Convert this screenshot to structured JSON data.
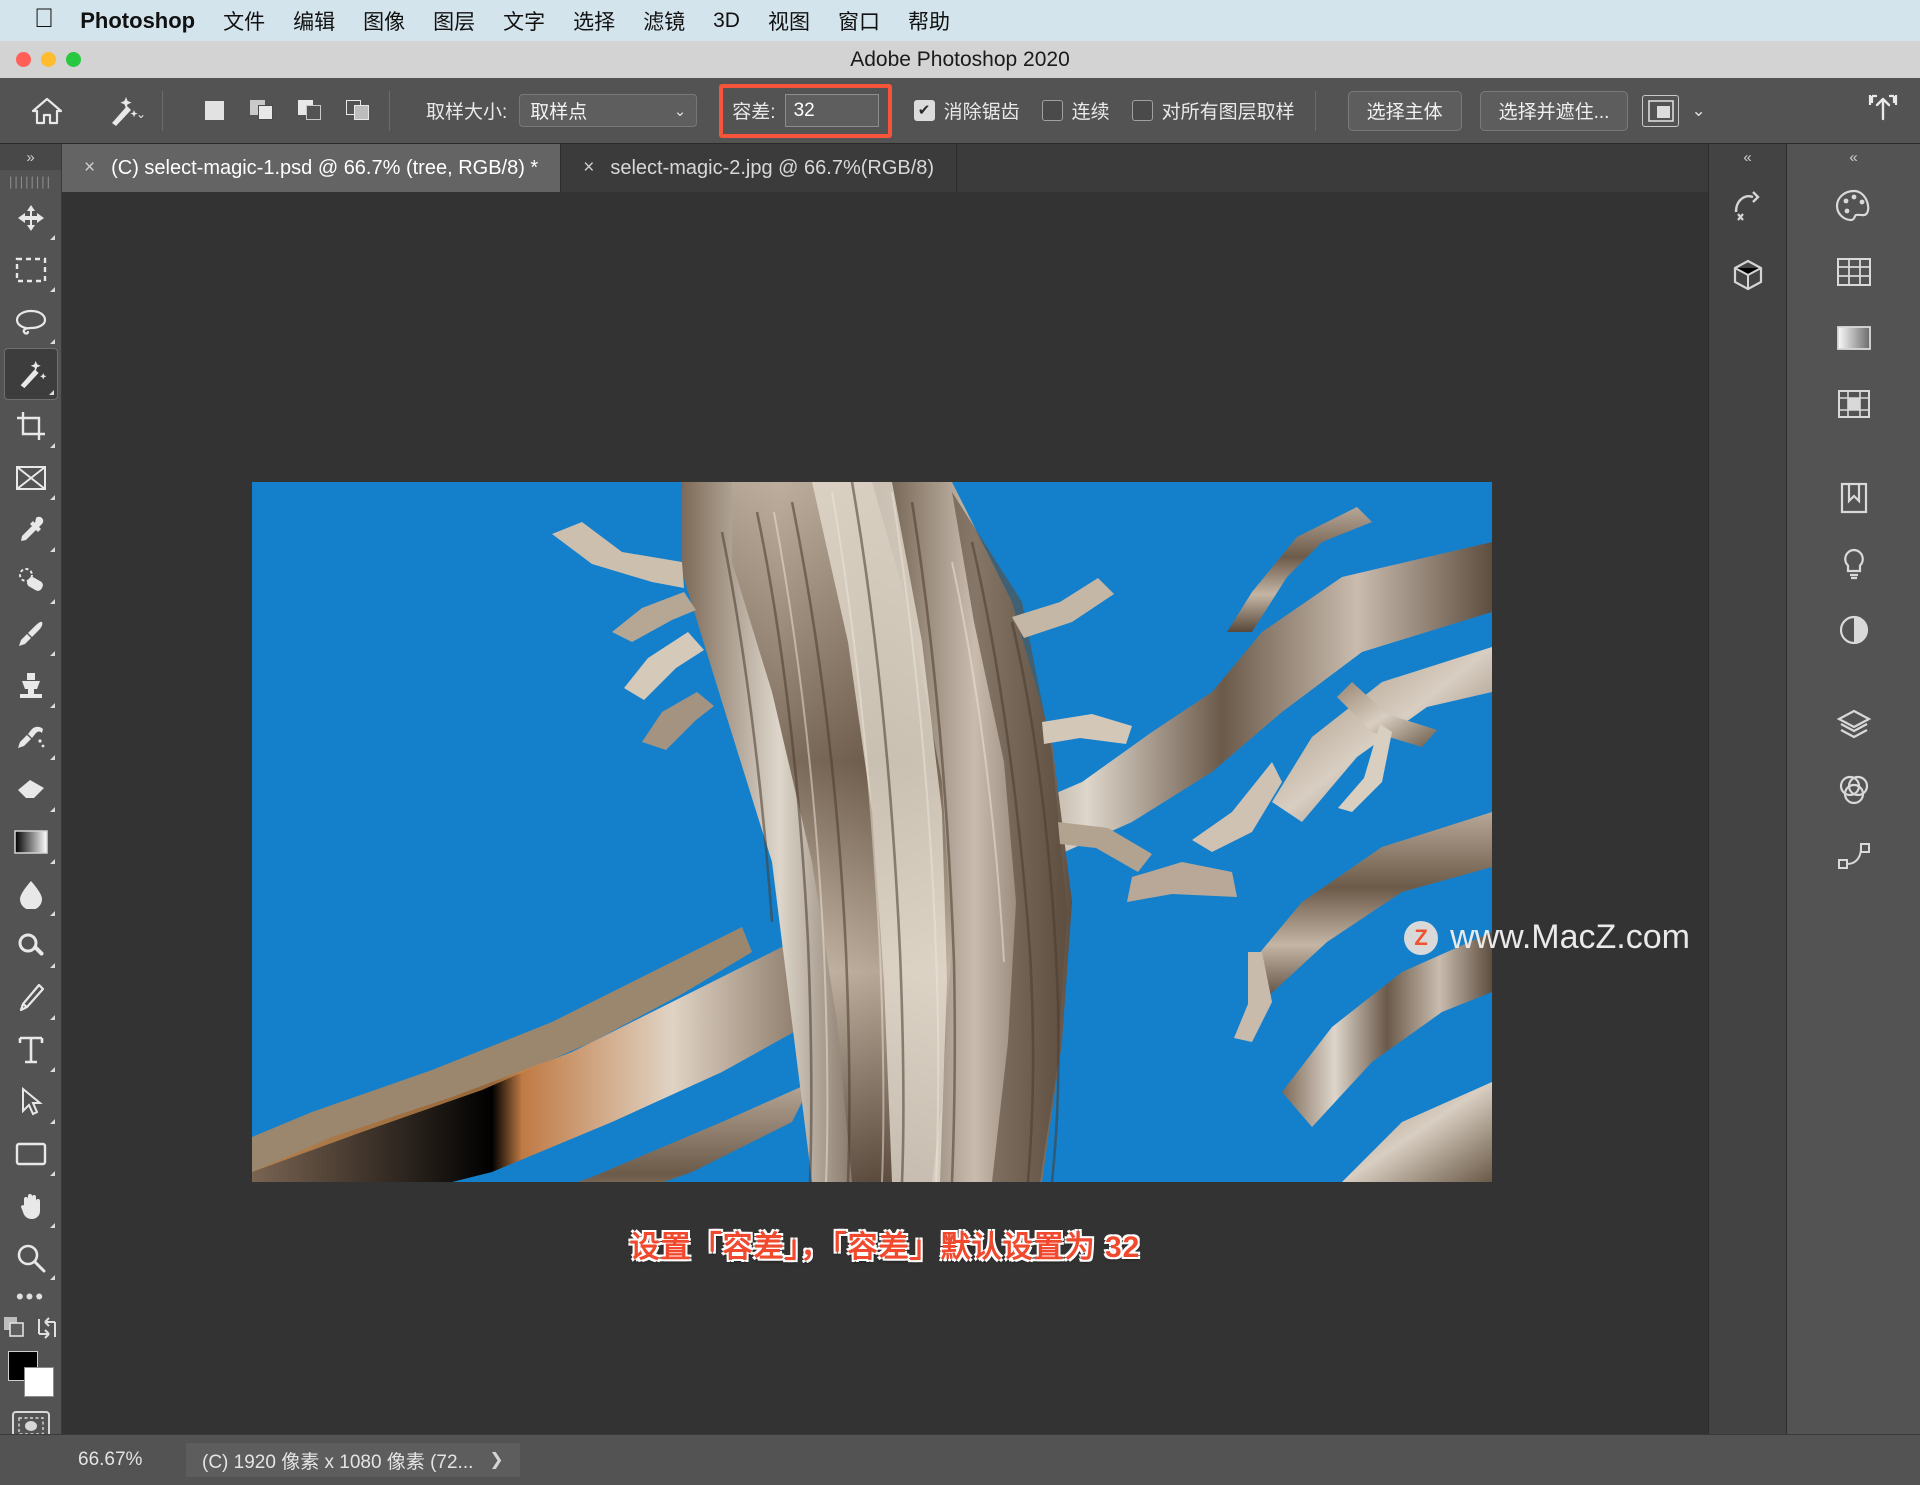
{
  "macmenu": {
    "apple_icon": "apple-icon",
    "app_name": "Photoshop",
    "items": [
      "文件",
      "编辑",
      "图像",
      "图层",
      "文字",
      "选择",
      "滤镜",
      "3D",
      "视图",
      "窗口",
      "帮助"
    ]
  },
  "window": {
    "title": "Adobe Photoshop 2020"
  },
  "options_bar": {
    "home_icon": "home-icon",
    "tool_icon": "magic-wand-icon",
    "tool_caret": "⌄",
    "selection_modes": [
      "new-selection-icon",
      "add-to-selection-icon",
      "subtract-from-selection-icon",
      "intersect-selection-icon"
    ],
    "sample_size_label": "取样大小:",
    "sample_size_value": "取样点",
    "sample_size_chevron": "⌄",
    "tolerance_label": "容差:",
    "tolerance_value": "32",
    "tolerance_highlight_color": "#f7543c",
    "antialias_label": "消除锯齿",
    "antialias_checked": true,
    "contiguous_label": "连续",
    "contiguous_checked": false,
    "sample_all_layers_label": "对所有图层取样",
    "sample_all_layers_checked": false,
    "select_subject_label": "选择主体",
    "select_and_mask_label": "选择并遮住...",
    "workspace_icon": "workspace-icon",
    "workspace_chevron": "⌄",
    "share_icon": "share-icon"
  },
  "toolbar": {
    "collapse_icon": "»",
    "tools": [
      {
        "name": "move-tool",
        "icon": "move-icon",
        "active": false
      },
      {
        "name": "marquee-tool",
        "icon": "rectangular-marquee-icon",
        "active": false
      },
      {
        "name": "lasso-tool",
        "icon": "lasso-icon",
        "active": false
      },
      {
        "name": "magic-wand-tool",
        "icon": "magic-wand-icon",
        "active": true
      },
      {
        "name": "crop-tool",
        "icon": "crop-icon",
        "active": false
      },
      {
        "name": "frame-tool",
        "icon": "frame-icon",
        "active": false
      },
      {
        "name": "eyedropper-tool",
        "icon": "eyedropper-icon",
        "active": false
      },
      {
        "name": "healing-brush-tool",
        "icon": "spot-healing-icon",
        "active": false
      },
      {
        "name": "brush-tool",
        "icon": "brush-icon",
        "active": false
      },
      {
        "name": "clone-stamp-tool",
        "icon": "clone-stamp-icon",
        "active": false
      },
      {
        "name": "history-brush-tool",
        "icon": "history-brush-icon",
        "active": false
      },
      {
        "name": "eraser-tool",
        "icon": "eraser-icon",
        "active": false
      },
      {
        "name": "gradient-tool",
        "icon": "gradient-icon",
        "active": false
      },
      {
        "name": "blur-tool",
        "icon": "blur-drop-icon",
        "active": false
      },
      {
        "name": "dodge-tool",
        "icon": "dodge-icon",
        "active": false
      },
      {
        "name": "pen-tool",
        "icon": "pen-icon",
        "active": false
      },
      {
        "name": "type-tool",
        "icon": "type-T-icon",
        "active": false
      },
      {
        "name": "path-selection-tool",
        "icon": "path-arrow-icon",
        "active": false
      },
      {
        "name": "shape-tool",
        "icon": "rectangle-shape-icon",
        "active": false
      },
      {
        "name": "hand-tool",
        "icon": "hand-icon",
        "active": false
      },
      {
        "name": "zoom-tool",
        "icon": "magnifier-icon",
        "active": false
      }
    ],
    "more_tools_icon": "•••",
    "edit_toolbar_icon": "edit-toolbar-icon",
    "screen_mode_icon": "screen-mode-icon",
    "foreground_color": "#000000",
    "background_color": "#ffffff",
    "quick_mask_icon": "quick-mask-icon"
  },
  "tabs": [
    {
      "close_icon": "×",
      "label": "(C) select-magic-1.psd @ 66.7% (tree, RGB/8) *",
      "active": true
    },
    {
      "close_icon": "×",
      "label": "select-magic-2.jpg @ 66.7%(RGB/8)",
      "active": false
    }
  ],
  "canvas": {
    "annotation": "设置「容差」，「容差」默认设置为 32",
    "annotation_color": "#f0492e",
    "watermark_badge": "Z",
    "watermark_text": "www.MacZ.com",
    "sky_color": "#1480cc"
  },
  "panel_icons": {
    "collapse_icon": "«",
    "items": [
      {
        "name": "history-panel-icon",
        "icon": "history-panel-icon"
      },
      {
        "name": "3d-panel-icon",
        "icon": "3d-panel-icon"
      }
    ]
  },
  "panel_right": {
    "collapse_icon": "«",
    "items": [
      {
        "name": "color-panel-icon",
        "icon": "palette-icon"
      },
      {
        "name": "swatches-panel-icon",
        "icon": "grid-icon"
      },
      {
        "name": "gradients-panel-icon",
        "icon": "gradient-bar-icon"
      },
      {
        "name": "patterns-panel-icon",
        "icon": "pattern-icon"
      },
      {
        "name": "adjustments-panel-icon",
        "icon": "bookmark-icon"
      },
      {
        "name": "styles-panel-icon",
        "icon": "bulb-icon"
      },
      {
        "name": "properties-panel-icon",
        "icon": "half-circle-icon"
      },
      {
        "name": "layers-panel-icon",
        "icon": "layers-icon"
      },
      {
        "name": "channels-panel-icon",
        "icon": "channels-icon"
      },
      {
        "name": "paths-panel-icon",
        "icon": "paths-icon"
      }
    ]
  },
  "status_bar": {
    "zoom_level": "66.67%",
    "doc_info": "(C) 1920 像素 x 1080 像素 (72...",
    "doc_info_arrow": "❯"
  }
}
